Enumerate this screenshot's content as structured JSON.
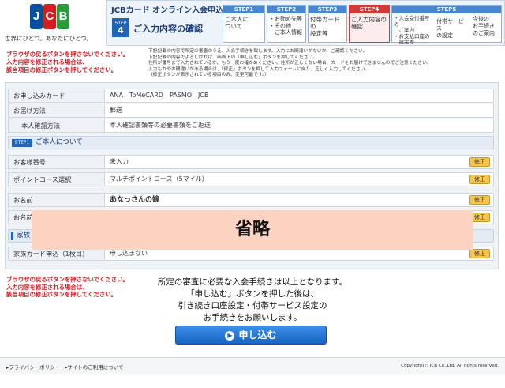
{
  "header": {
    "logo_text": [
      "J",
      "C",
      "B"
    ],
    "tagline": "世界にひとつ。あなたにひとつ。",
    "app_title": "JCBカード オンライン入会申込",
    "step_badge_label": "STEP",
    "step_badge_number": "4",
    "page_title": "ご入力内容の確認"
  },
  "steps": [
    {
      "header": "STEP1",
      "body": "ご本人に\nついて"
    },
    {
      "header": "STEP2",
      "body": "・お勤め先等\n・その他\n　ご本人情報"
    },
    {
      "header": "STEP3",
      "body": "付帯カードの\n設定等"
    },
    {
      "header": "STEP4",
      "body": "ご入力内容の\n確認"
    },
    {
      "header": "STEP5",
      "body": "・入会受付番号の\n　ご案内\n・お支払口座の\n　設定等"
    },
    {
      "header": "",
      "body": "付帯サービス\nの設定"
    },
    {
      "header": "",
      "body": "今後の\nお手続き\nのご案内"
    }
  ],
  "notes": {
    "left": "ブラウザの戻るボタンを押さないでください。\n入力内容を修正される場合は、\n該当項目の修正ボタンを押してください。",
    "right": "下記記載の内容で所定の審査のうえ、入会手続きを致します。入力にお間違いがないか、ご確認ください。\n下記記載の内容でよろしければ、画面下の「申し込む」ボタンを押してください。\n住所が番号まで入力されているか、もう一度お確かめください。住所が正しくない場合、カードをお届けできませんのでご注意ください。\n入力もれやお間違いがある場合は、「修正」ボタンを押して入力フォームに戻り、正しく入力してください。\n（修正ボタンが表示されている項目のみ、変更可能です。）"
  },
  "rows": {
    "card": {
      "label": "お申し込みカード",
      "value": "ANA　ToMeCARD　PASMO　JCB"
    },
    "delivery": {
      "label": "お届け方法",
      "value": "郵送"
    },
    "id_check": {
      "label": "本人確認方法",
      "value": "本人確認書類等の必要書類をご返送"
    },
    "section1": {
      "badge": "STEP1",
      "title": "ご本人について"
    },
    "member_no": {
      "label": "お客様番号",
      "value": "未入力",
      "edit": "修正"
    },
    "point_course": {
      "label": "ポイントコース選択",
      "value": "マルチポイントコース（5マイル）",
      "edit": "修正"
    },
    "name": {
      "label": "お名前",
      "value": "あなっさんの嫁",
      "edit": "修正"
    },
    "name_kana": {
      "label": "お名前",
      "value": "",
      "edit": "修正"
    },
    "family_section": {
      "title": "家族"
    },
    "family_card": {
      "label": "家族カード申込（1枚目）",
      "value": "申し込まない",
      "edit": "修正"
    }
  },
  "overlay": {
    "text": "省略"
  },
  "bottom": {
    "note": "ブラウザの戻るボタンを押さないでください。\n入力内容を修正される場合は、\n該当項目の修正ボタンを押してください。",
    "message": "所定の審査に必要な入会手続きは以上となります。\n「申し込む」ボタンを押した後は、\n引き続き口座設定・付帯サービス設定の\nお手続きをお願いします。",
    "submit_label": "申し込む",
    "submit_arrow": "▶"
  },
  "footer": {
    "privacy": "▸プライバシーポリシー",
    "terms": "▸サイトのご利用について",
    "copyright": "Copyright(c) JCB Co.,Ltd. All rights reserved."
  },
  "colors": {
    "brand_blue": "#1f65b7",
    "accent_red": "#d3141b",
    "edit_yellow": "#f6c54b",
    "overlay_peach": "#fcd3c1"
  }
}
